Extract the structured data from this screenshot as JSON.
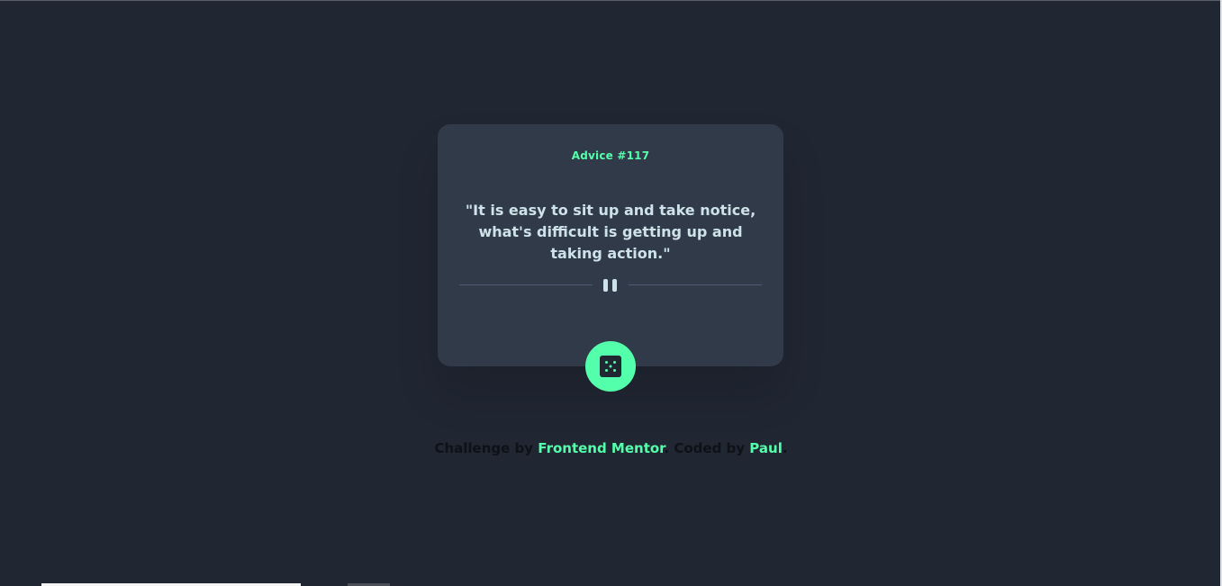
{
  "card": {
    "advice_label": "Advice #117",
    "quote": "\"It is easy to sit up and take notice, what's difficult is getting up and taking action.\""
  },
  "divider": {
    "icon": "pause-icon"
  },
  "dice_button": {
    "icon": "dice-icon"
  },
  "attribution": {
    "prefix": "Challenge by ",
    "link_1": "Frontend Mentor",
    "middle": ". Coded by ",
    "link_2": "Paul",
    "suffix": "."
  },
  "colors": {
    "background": "#202632",
    "card": "#313a49",
    "accent": "#53ffaa",
    "quote_text": "#cee3e9",
    "divider": "#4f5d74"
  }
}
